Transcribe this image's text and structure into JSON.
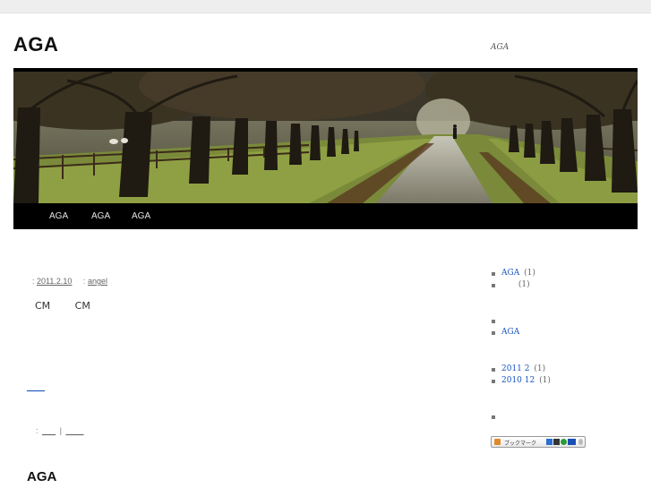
{
  "site": {
    "title": "AGA",
    "description": "AGA"
  },
  "nav": {
    "items": [
      {
        "label": "AGA"
      },
      {
        "label": "AGA"
      },
      {
        "label": "AGA"
      }
    ]
  },
  "post": {
    "meta_prefix": ":",
    "date": "2011.2.10",
    "author_prefix": ":",
    "author": "angel",
    "body_1": "CM",
    "body_2": "CM",
    "more_link": "____",
    "footer_prefix": ":",
    "footer_link_1": "___",
    "footer_separator": "|",
    "footer_link_2": "____"
  },
  "next_post": {
    "title": "AGA"
  },
  "sidebar": {
    "categories": [
      {
        "label": "AGA",
        "count": "(1)"
      },
      {
        "label": "",
        "count": "(1)"
      }
    ],
    "pages": [
      {
        "label": ""
      },
      {
        "label": "AGA"
      }
    ],
    "archives": [
      {
        "label": "2011 2",
        "count": "(1)"
      },
      {
        "label": "2010 12",
        "count": "(1)"
      }
    ],
    "meta": [
      {
        "label": ""
      }
    ],
    "bookmark_button": {
      "label": "ブックマーク",
      "icons": [
        "hatena-icon",
        "delicious-icon",
        "livedoor-icon",
        "buzzurl-icon",
        "plus-icon"
      ]
    }
  }
}
